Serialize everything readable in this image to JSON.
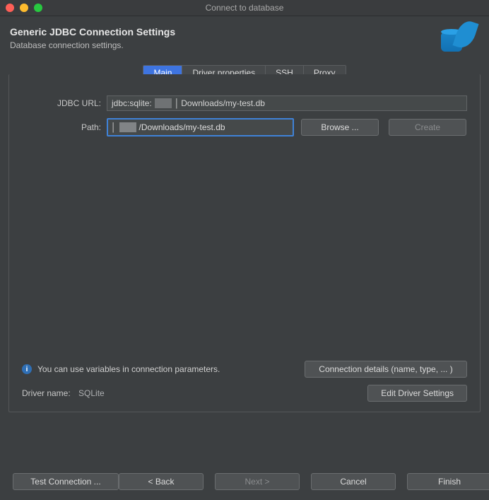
{
  "window": {
    "title": "Connect to database"
  },
  "header": {
    "title": "Generic JDBC Connection Settings",
    "subtitle": "Database connection settings."
  },
  "tabs": {
    "main": "Main",
    "driver": "Driver properties",
    "ssh": "SSH",
    "proxy": "Proxy"
  },
  "form": {
    "jdbc_label": "JDBC URL:",
    "jdbc_prefix": "jdbc:sqlite:",
    "jdbc_suffix": "Downloads/my-test.db",
    "path_label": "Path:",
    "path_value": "/Downloads/my-test.db",
    "browse": "Browse ...",
    "create": "Create"
  },
  "info": {
    "text": "You can use variables in connection parameters.",
    "connection_details": "Connection details (name, type, ... )"
  },
  "driver": {
    "label": "Driver name:",
    "value": "SQLite",
    "edit": "Edit Driver Settings"
  },
  "footer": {
    "test": "Test Connection ...",
    "back": "< Back",
    "next": "Next >",
    "cancel": "Cancel",
    "finish": "Finish"
  },
  "icons": {
    "close": "close-icon",
    "minimize": "minimize-icon",
    "maximize": "maximize-icon",
    "db": "database-feather-icon",
    "info": "info-icon"
  }
}
